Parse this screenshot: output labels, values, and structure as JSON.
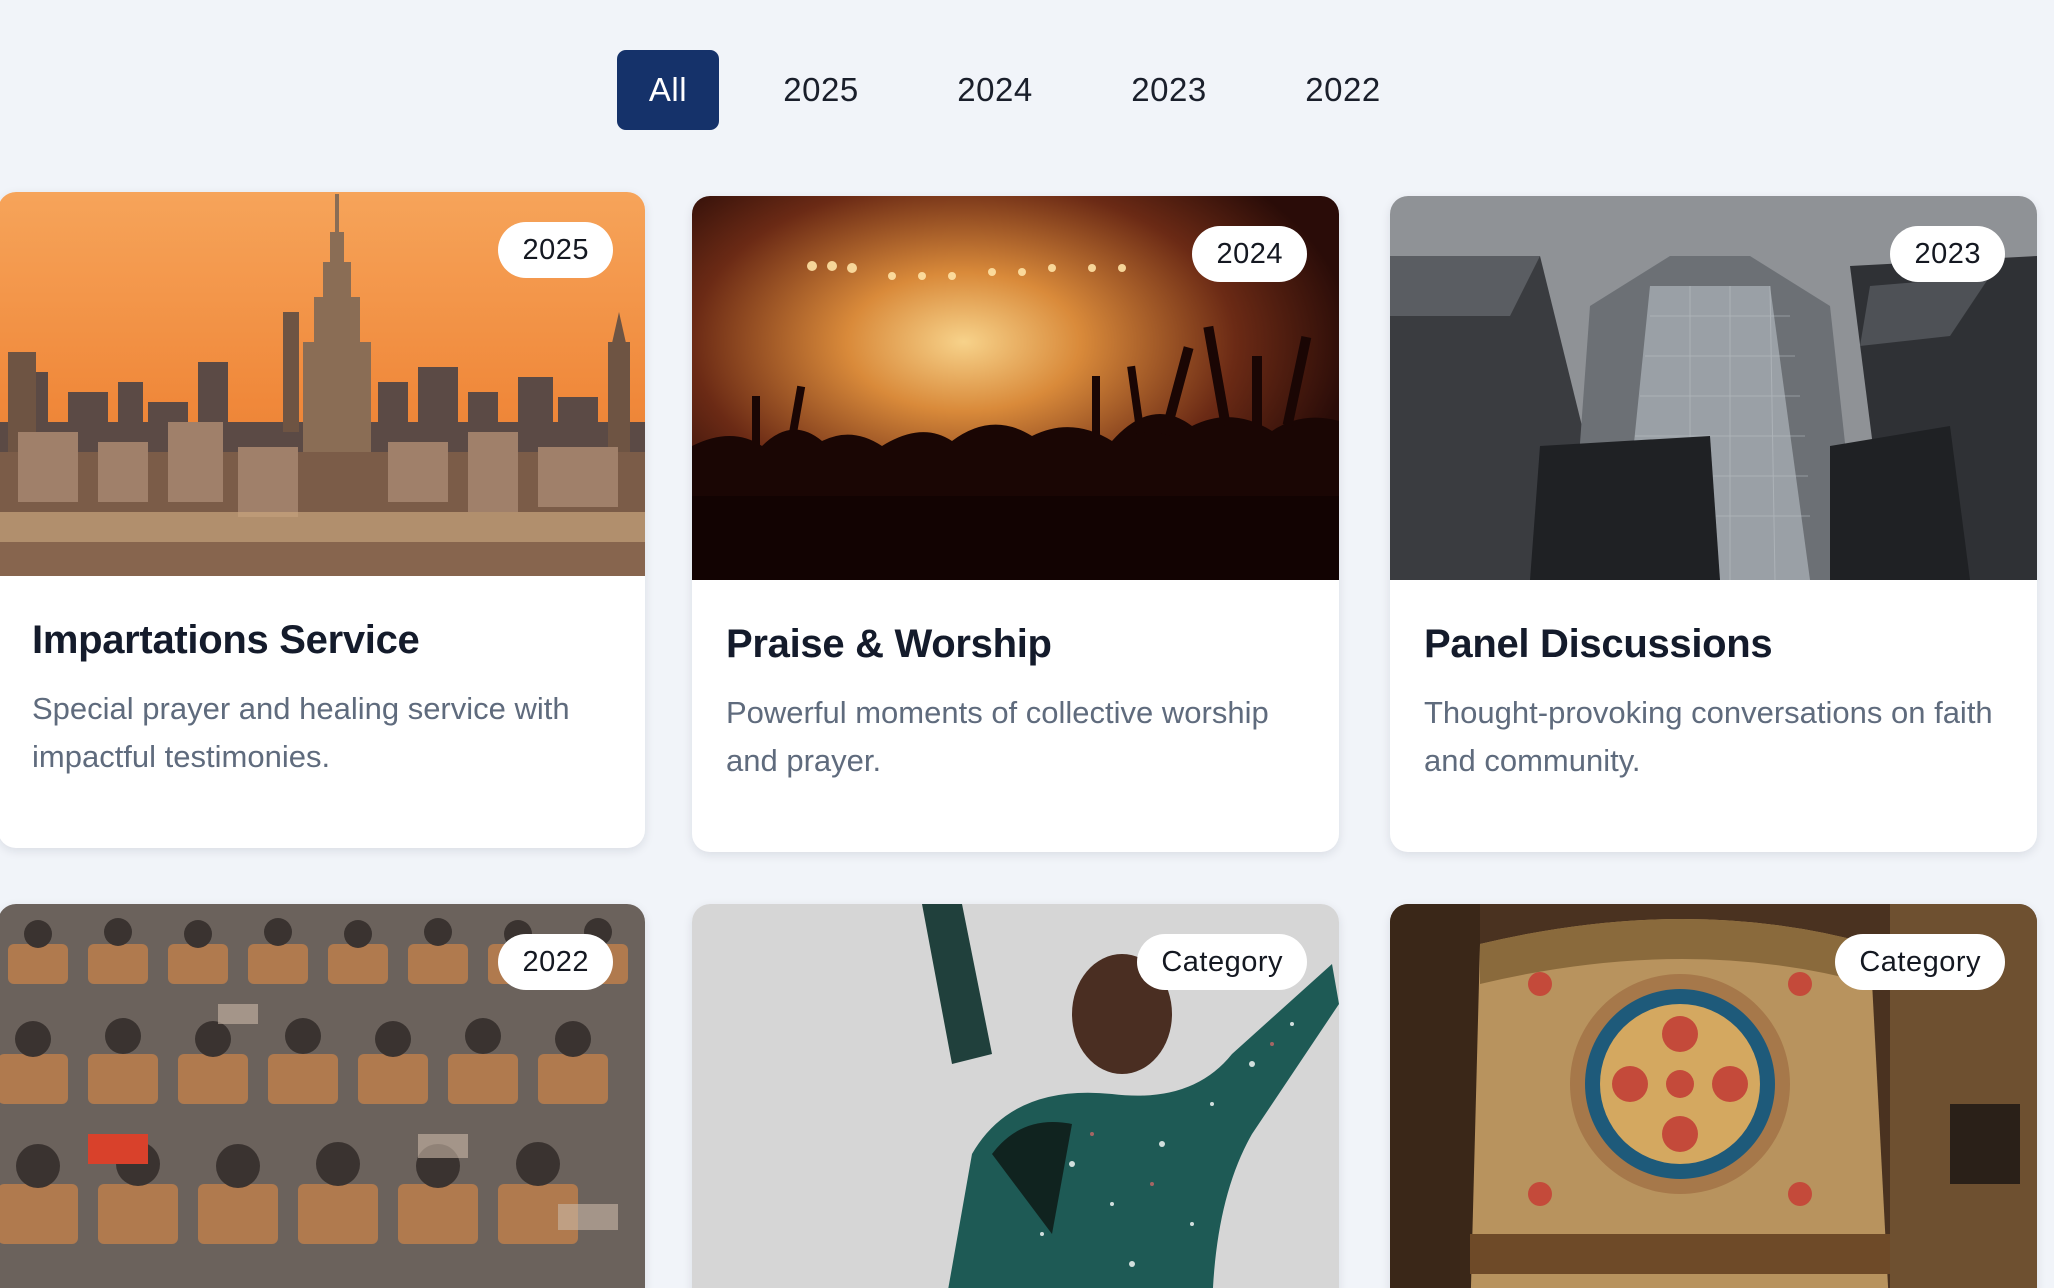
{
  "filters": {
    "items": [
      {
        "label": "All",
        "active": true
      },
      {
        "label": "2025",
        "active": false
      },
      {
        "label": "2024",
        "active": false
      },
      {
        "label": "2023",
        "active": false
      },
      {
        "label": "2022",
        "active": false
      }
    ]
  },
  "cards": [
    {
      "badge": "2025",
      "title": "Impartations Service",
      "description": "Special prayer and healing service with impactful testimonies.",
      "image": "city-skyline-sunset"
    },
    {
      "badge": "2024",
      "title": "Praise & Worship",
      "description": "Powerful moments of collective worship and prayer.",
      "image": "concert-crowd"
    },
    {
      "badge": "2023",
      "title": "Panel Discussions",
      "description": "Thought-provoking conversations on faith and community.",
      "image": "glass-skyscrapers"
    },
    {
      "badge": "2022",
      "title": "",
      "description": "",
      "image": "lecture-hall-audience"
    },
    {
      "badge": "Category",
      "title": "",
      "description": "",
      "image": "woman-celebrating-confetti"
    },
    {
      "badge": "Category",
      "title": "",
      "description": "",
      "image": "ornate-wooden-pulpit"
    }
  ],
  "colors": {
    "background": "#f1f4f9",
    "active_filter": "#15326a",
    "title": "#141b2b",
    "description": "#5f6b7d"
  }
}
